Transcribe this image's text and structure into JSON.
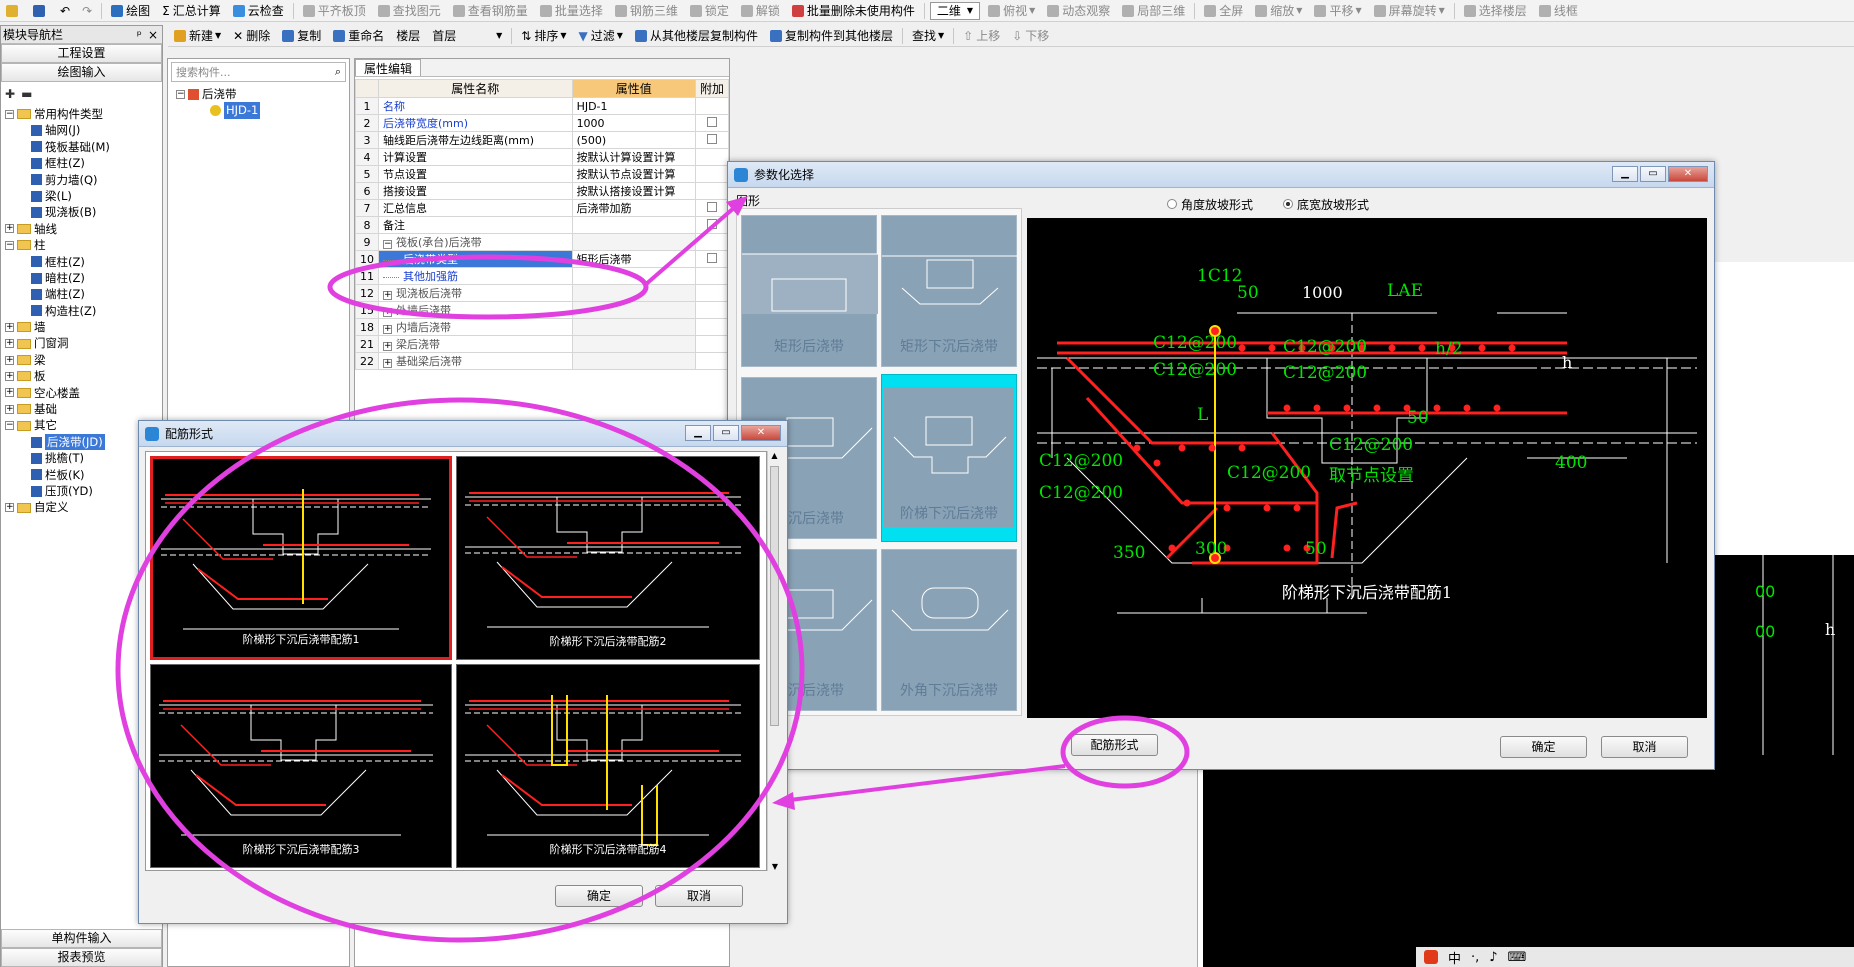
{
  "toolbar1": {
    "items": [
      "绘图",
      "汇总计算",
      "云检查",
      "平齐板顶",
      "查找图元",
      "查看钢筋量",
      "批量选择",
      "钢筋三维",
      "锁定",
      "解锁",
      "批量删除未使用构件"
    ],
    "view_mode": "二维",
    "items2": [
      "俯视",
      "动态观察",
      "局部三维",
      "全屏",
      "缩放",
      "平移",
      "屏幕旋转",
      "选择楼层",
      "线框"
    ]
  },
  "toolbar2": {
    "new": "新建",
    "delete": "删除",
    "copy": "复制",
    "rename": "重命名",
    "floor_label": "楼层",
    "floor_value": "首层",
    "sort": "排序",
    "filter": "过滤",
    "copy_from": "从其他楼层复制构件",
    "copy_to": "复制构件到其他楼层",
    "find": "查找",
    "up": "上移",
    "down": "下移"
  },
  "nav": {
    "title": "模块导航栏",
    "pin": "ᵖ",
    "close": "×",
    "btn_project": "工程设置",
    "btn_draw": "绘图输入",
    "btn_single": "单构件输入",
    "btn_report": "报表预览",
    "tree": [
      {
        "level": 0,
        "pm": "−",
        "type": "fold",
        "label": "常用构件类型"
      },
      {
        "level": 2,
        "type": "comp",
        "label": "轴网(J)"
      },
      {
        "level": 2,
        "type": "comp",
        "label": "筏板基础(M)"
      },
      {
        "level": 2,
        "type": "comp",
        "label": "框柱(Z)"
      },
      {
        "level": 2,
        "type": "comp",
        "label": "剪力墙(Q)"
      },
      {
        "level": 2,
        "type": "comp",
        "label": "梁(L)"
      },
      {
        "level": 2,
        "type": "comp",
        "label": "现浇板(B)"
      },
      {
        "level": 0,
        "pm": "+",
        "type": "fold",
        "label": "轴线"
      },
      {
        "level": 0,
        "pm": "−",
        "type": "fold",
        "label": "柱"
      },
      {
        "level": 2,
        "type": "comp",
        "label": "框柱(Z)"
      },
      {
        "level": 2,
        "type": "comp",
        "label": "暗柱(Z)"
      },
      {
        "level": 2,
        "type": "comp",
        "label": "端柱(Z)"
      },
      {
        "level": 2,
        "type": "comp",
        "label": "构造柱(Z)"
      },
      {
        "level": 0,
        "pm": "+",
        "type": "fold",
        "label": "墙"
      },
      {
        "level": 0,
        "pm": "+",
        "type": "fold",
        "label": "门窗洞"
      },
      {
        "level": 0,
        "pm": "+",
        "type": "fold",
        "label": "梁"
      },
      {
        "level": 0,
        "pm": "+",
        "type": "fold",
        "label": "板"
      },
      {
        "level": 0,
        "pm": "+",
        "type": "fold",
        "label": "空心楼盖"
      },
      {
        "level": 0,
        "pm": "+",
        "type": "fold",
        "label": "基础"
      },
      {
        "level": 0,
        "pm": "−",
        "type": "fold",
        "label": "其它"
      },
      {
        "level": 2,
        "type": "comp",
        "label": "后浇带(JD)",
        "selected": true
      },
      {
        "level": 2,
        "type": "comp",
        "label": "挑檐(T)"
      },
      {
        "level": 2,
        "type": "comp",
        "label": "栏板(K)"
      },
      {
        "level": 2,
        "type": "comp",
        "label": "压顶(YD)"
      },
      {
        "level": 0,
        "pm": "+",
        "type": "fold",
        "label": "自定义"
      }
    ]
  },
  "component_list": {
    "search_placeholder": "搜索构件...",
    "root": "后浇带",
    "child": "HJD-1"
  },
  "props": {
    "tab": "属性编辑",
    "headers": [
      "属性名称",
      "属性值",
      "附加"
    ],
    "rows": [
      {
        "no": "1",
        "name": "名称",
        "value": "HJD-1",
        "blue": true,
        "check": false
      },
      {
        "no": "2",
        "name": "后浇带宽度(mm)",
        "value": "1000",
        "blue": true,
        "check": true
      },
      {
        "no": "3",
        "name": "轴线距后浇带左边线距离(mm)",
        "value": "(500)",
        "check": true
      },
      {
        "no": "4",
        "name": "计算设置",
        "value": "按默认计算设置计算",
        "check": false
      },
      {
        "no": "5",
        "name": "节点设置",
        "value": "按默认节点设置计算",
        "check": false
      },
      {
        "no": "6",
        "name": "搭接设置",
        "value": "按默认搭接设置计算",
        "check": false
      },
      {
        "no": "7",
        "name": "汇总信息",
        "value": "后浇带加筋",
        "check": true
      },
      {
        "no": "8",
        "name": "备注",
        "value": "",
        "check": true
      },
      {
        "no": "9",
        "name": "筏板(承台)后浇带",
        "value": "",
        "group": "−"
      },
      {
        "no": "10",
        "name": "后浇带类型",
        "value": "矩形后浇带",
        "sel": true,
        "check": true,
        "indent": true
      },
      {
        "no": "11",
        "name": "其他加强筋",
        "value": "",
        "blue": true,
        "indent": true
      },
      {
        "no": "12",
        "name": "现浇板后浇带",
        "value": "",
        "group": "+"
      },
      {
        "no": "15",
        "name": "外墙后浇带",
        "value": "",
        "group": "+"
      },
      {
        "no": "18",
        "name": "内墙后浇带",
        "value": "",
        "group": "+"
      },
      {
        "no": "21",
        "name": "梁后浇带",
        "value": "",
        "group": "+"
      },
      {
        "no": "22",
        "name": "基础梁后浇带",
        "value": "",
        "group": "+"
      }
    ]
  },
  "param_dialog": {
    "title": "参数化选择",
    "group_label": "图形",
    "radio1": "角度放坡形式",
    "radio2": "底宽放坡形式",
    "shapes": [
      "矩形后浇带",
      "矩形下沉后浇带",
      "下沉后浇带",
      "阶梯下沉后浇带",
      "下沉后浇带",
      "外角下沉后浇带"
    ],
    "drawing": {
      "title": "阶梯形下沉后浇带配筋1",
      "labels": [
        "1C12",
        "50",
        "1000",
        "LAE",
        "h/2",
        "h",
        "50",
        "400",
        "350",
        "300",
        "50",
        "L",
        "C12@200",
        "C12@200",
        "C12@200",
        "C12@200",
        "C12@200",
        "C12@200",
        "C12@200",
        "C12@200",
        "取节点设置"
      ]
    },
    "btn_rebar": "配筋形式",
    "btn_ok": "确定",
    "btn_cancel": "取消"
  },
  "rebar_dialog": {
    "title": "配筋形式",
    "captions": [
      "阶梯形下沉后浇带配筋1",
      "阶梯形下沉后浇带配筋2",
      "阶梯形下沉后浇带配筋3",
      "阶梯形下沉后浇带配筋4"
    ],
    "btn_ok": "确定",
    "btn_cancel": "取消"
  },
  "bg_canvas": {
    "labels": [
      "h",
      "00",
      "00"
    ]
  },
  "taskbar": {
    "text": "中"
  },
  "colors": {
    "highlight": "#e040e0",
    "selection": "#3b78d8",
    "rebar": "#ff2020",
    "dim": "#00e600"
  }
}
